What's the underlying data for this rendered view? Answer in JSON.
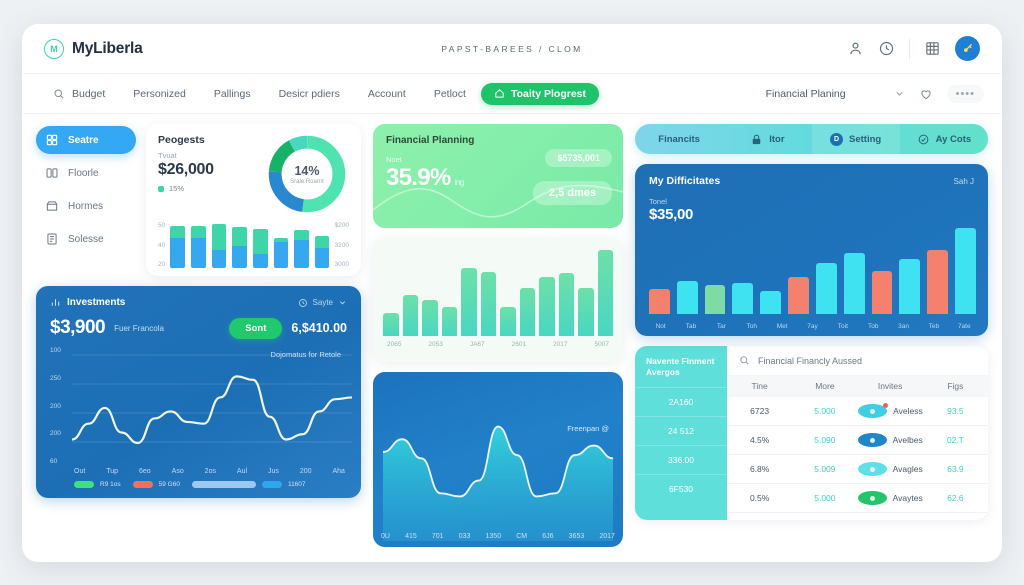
{
  "topbar": {
    "brand_mark": "M",
    "brand_name": "MyLiberla",
    "breadcrumb": "PAPST-BAREES / CLOM",
    "icons": [
      "user-icon",
      "clock-icon",
      "grid-icon",
      "avatar-icon"
    ]
  },
  "nav": {
    "search_label": "Budget",
    "items": [
      "Personized",
      "Pallings",
      "Desicr pdiers",
      "Account",
      "Petloct"
    ],
    "active_label": "Toaity Plogrest",
    "select_value": "Financial Planing",
    "dots": "••••"
  },
  "sidebar": {
    "items": [
      {
        "label": "Seatre",
        "icon": "grid-icon",
        "active": true
      },
      {
        "label": "Floorle",
        "icon": "calendar-icon",
        "active": false
      },
      {
        "label": "Hormes",
        "icon": "inbox-icon",
        "active": false
      },
      {
        "label": "Solesse",
        "icon": "note-icon",
        "active": false
      }
    ]
  },
  "progress": {
    "title": "Peogests",
    "sub": "Tvuat",
    "amount": "$26,000",
    "legend": "15%",
    "donut": {
      "center_pct": "14%",
      "center_label": "Srale Roarnt",
      "slices": [
        {
          "name": "mint",
          "value": 52,
          "color": "#4fe3b0"
        },
        {
          "name": "blue",
          "value": 24,
          "color": "#2a88d0"
        },
        {
          "name": "green",
          "value": 16,
          "color": "#17b26a"
        },
        {
          "name": "teal",
          "value": 8,
          "color": "#49d8bd"
        }
      ]
    },
    "mini_chart": {
      "type": "bar",
      "y_ticks": [
        "50",
        "40",
        "20"
      ],
      "right_ticks": [
        "$200",
        "3200",
        "3000"
      ],
      "bottom": [
        30,
        30,
        18,
        22,
        14,
        26,
        28,
        20
      ],
      "top": [
        12,
        12,
        26,
        19,
        25,
        4,
        10,
        12
      ]
    }
  },
  "investments": {
    "title": "Investments",
    "title_icon": "bars-icon",
    "right_label": "Sayte",
    "right_icon": "clock-icon",
    "amount": "$3,900",
    "amount_sub": "Fuer Francola",
    "button": "Sont",
    "amount2": "6,$410.00",
    "chart": {
      "type": "line",
      "note": "Dojomatus for Retole",
      "y_ticks": [
        "100",
        "250",
        "200",
        "200",
        "60"
      ],
      "x_ticks": [
        "Out",
        "Tup",
        "6eo",
        "Aso",
        "2os",
        "Aul",
        "Jus",
        "200",
        "Aha"
      ],
      "values": [
        200,
        218,
        236,
        208,
        196,
        224,
        232,
        220,
        218,
        248,
        272,
        268,
        226,
        200,
        206,
        232,
        246,
        248
      ]
    },
    "legend": [
      {
        "label": "R9 1os",
        "color": "#3fe07f",
        "wide": false
      },
      {
        "label": "59 G60",
        "color": "#f4705c",
        "wide": false
      },
      {
        "label": "",
        "color": "#9ec8f0",
        "wide": true
      },
      {
        "label": "11607",
        "color": "#2ea6f0",
        "wide": false
      }
    ]
  },
  "green_card": {
    "title": "Financial Planning",
    "sub": "Noet",
    "pct": "35.9%",
    "pct_suffix": "ing",
    "pill_top": "$5735,001",
    "pill_bottom": "2,5 dmes"
  },
  "green_bars": {
    "type": "bar",
    "x_ticks": [
      "2065",
      "2053",
      "JA67",
      "2601",
      "2017",
      "5007"
    ],
    "values": [
      26,
      46,
      40,
      32,
      76,
      72,
      32,
      54,
      66,
      70,
      54,
      96
    ]
  },
  "blue_area": {
    "type": "area",
    "note": "Freenpan @",
    "x_ticks": [
      "0U",
      "415",
      "701",
      "033",
      "1350",
      "CM",
      "6J6",
      "3653",
      "2017"
    ],
    "values": [
      62,
      70,
      58,
      36,
      34,
      44,
      78,
      60,
      34,
      36,
      60,
      66,
      58
    ]
  },
  "segments": {
    "items": [
      {
        "label": "Financits",
        "icon": "none",
        "active": false
      },
      {
        "label": "Itor",
        "icon": "lock-icon",
        "active": false
      },
      {
        "label": "Setting",
        "icon": "badge-icon",
        "active": true
      },
      {
        "label": "Ay Cots",
        "icon": "tag-icon",
        "active": false
      }
    ]
  },
  "difficulties": {
    "title": "My Difficitates",
    "right": "Sah J",
    "sub": "Tonel",
    "amount": "$35,00",
    "chart": {
      "type": "bar",
      "x_ticks": [
        "Not",
        "Tab",
        "Tar",
        "Toh",
        "Met",
        "7ay",
        "Toit",
        "Tob",
        "3an",
        "Teb",
        "7ate"
      ],
      "values": [
        26,
        34,
        30,
        32,
        24,
        38,
        52,
        62,
        44,
        56,
        66,
        88
      ],
      "colors": [
        "#f4806e",
        "#3fe2f0",
        "#7ddba4",
        "#3fe2f0",
        "#3fe2f0",
        "#f4806e",
        "#3fe2f0",
        "#3fe2f0",
        "#f4806e",
        "#3fe2f0",
        "#f4806e",
        "#3fe2f0"
      ]
    }
  },
  "table": {
    "left_header": "Navente Finment Avergos",
    "left_rows": [
      "2A160",
      "24 512",
      "336.00",
      "6F530"
    ],
    "search_placeholder": "Financial Financly Aussed",
    "headers": [
      "Tine",
      "More",
      "Invites",
      "Figs"
    ],
    "rows": [
      {
        "tine": "6723",
        "more": "5.000",
        "invites": "Aveless",
        "figs": "93.5",
        "avatar": "#3ecfe0",
        "badge": true
      },
      {
        "tine": "4.5%",
        "more": "5.090",
        "invites": "Avelbes",
        "figs": "02.T",
        "avatar": "#1f86c8",
        "badge": false
      },
      {
        "tine": "6.8%",
        "more": "5.009",
        "invites": "Avagles",
        "figs": "63.9",
        "avatar": "#5fdfe8",
        "badge": false
      },
      {
        "tine": "0.5%",
        "more": "5.000",
        "invites": "Avaytes",
        "figs": "62.6",
        "avatar": "#25c46b",
        "badge": false
      }
    ]
  }
}
